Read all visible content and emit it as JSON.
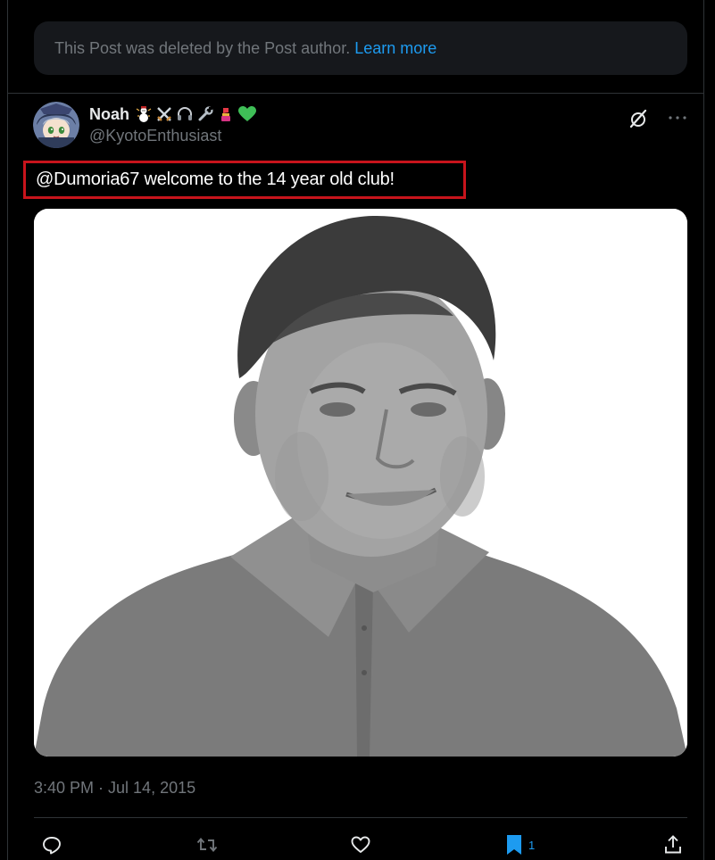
{
  "deleted_notice": {
    "text": "This Post was deleted by the Post author.",
    "link": "Learn more"
  },
  "author": {
    "display_name": "Noah",
    "handle": "@KyotoEnthusiast",
    "name_emojis": [
      "snowman-icon",
      "crossed-swords-icon",
      "headphones-icon",
      "wrench-icon",
      "lipstick-icon",
      "green-heart-icon"
    ]
  },
  "tweet": {
    "text": "@Dumoria67 welcome to the 14 year old club!",
    "timestamp": "3:40 PM · Jul 14, 2015"
  },
  "actions": {
    "reply_icon": "reply-icon",
    "repost_icon": "repost-icon",
    "like_icon": "heart-icon",
    "bookmark_icon": "bookmark-icon",
    "bookmark_count": "1",
    "share_icon": "share-icon"
  },
  "colors": {
    "background": "#000000",
    "accent": "#1d9bf0",
    "muted": "#71767b",
    "highlight_box": "#c8141c"
  }
}
